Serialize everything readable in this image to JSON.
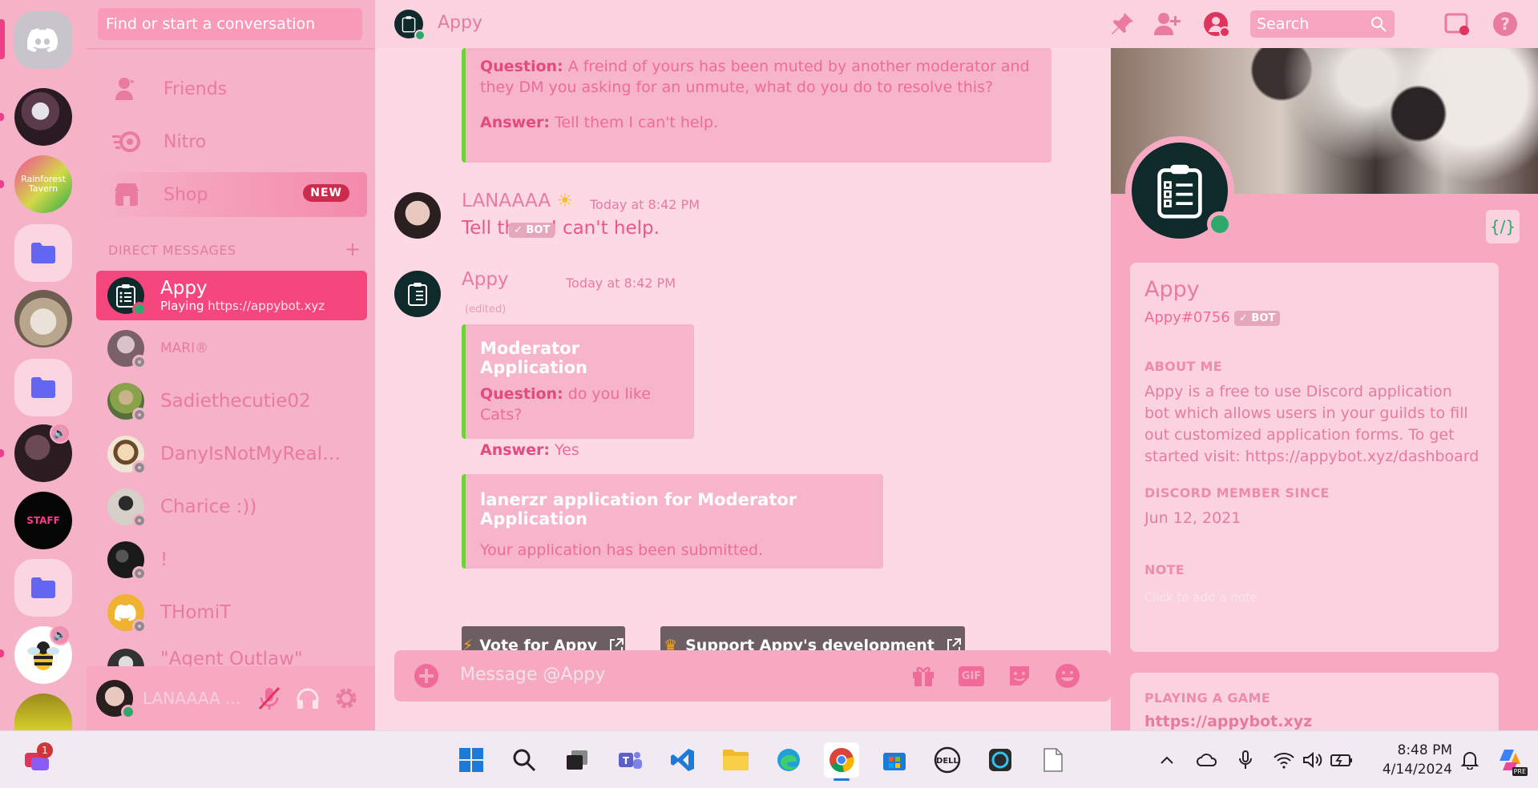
{
  "sidebar": {
    "search_placeholder": "Find or start a conversation",
    "nav": [
      {
        "label": "Friends"
      },
      {
        "label": "Nitro"
      },
      {
        "label": "Shop",
        "badge": "NEW"
      }
    ],
    "dm_header": "DIRECT MESSAGES",
    "dms": [
      {
        "name": "Appy",
        "status": "Playing ",
        "status_link": "https://appybot.xyz"
      },
      {
        "name": "MARI®"
      },
      {
        "name": "Sadiethecutie02"
      },
      {
        "name": "DanyIsNotMyRealNa..."
      },
      {
        "name": "Charice :))"
      },
      {
        "name": "!"
      },
      {
        "name": "THomiT"
      },
      {
        "name": "\"Agent Outlaw\""
      }
    ],
    "user_panel": {
      "name": "LANAAAA ..."
    }
  },
  "topbar": {
    "title": "Appy",
    "search_placeholder": "Search"
  },
  "chat": {
    "prev_embed": {
      "q_label": "Question:",
      "q_text": "A freind of yours has been muted by another moderator and they DM you asking for an unmute, what do you do to resolve this?",
      "a_label": "Answer:",
      "a_text": "Tell them I can't help."
    },
    "msg1": {
      "author": "LANAAAA",
      "time": "Today at 8:42 PM",
      "text": "Tell them I can't help."
    },
    "msg2": {
      "author": "Appy",
      "badge": "✓ BOT",
      "time": "Today at 8:42 PM",
      "edited": "(edited)",
      "embed1": {
        "title": "Moderator Application",
        "q_label": "Question:",
        "q_text": "do you like Cats?",
        "a_label": "Answer:",
        "a_text": "Yes"
      },
      "embed2": {
        "title": "lanerzr application for Moderator Application",
        "text": "Your application has been submitted."
      },
      "btn_vote": "Vote for Appy",
      "btn_support": "Support Appy's development"
    },
    "composer_placeholder": "Message @Appy",
    "gif_label": "GIF"
  },
  "profile": {
    "name": "Appy",
    "tag": "Appy#0756",
    "badge": "✓ BOT",
    "about_h": "ABOUT ME",
    "about": "Appy is a free to use Discord application bot which allows users in your guilds to fill out customized application forms. To get started visit: https://appybot.xyz/dashboard",
    "since_h": "DISCORD MEMBER SINCE",
    "since": "Jun 12, 2021",
    "note_h": "NOTE",
    "note_ph": "Click to add a note",
    "playing_h": "PLAYING A GAME",
    "playing": "https://appybot.xyz"
  },
  "taskbar": {
    "time": "8:48 PM",
    "date": "4/14/2024",
    "notif_count": "1",
    "copilot_label": "PRE"
  },
  "colors": {
    "accent": "#f5477e",
    "online": "#2ea86b",
    "embed_bar": "#6fd13b"
  }
}
